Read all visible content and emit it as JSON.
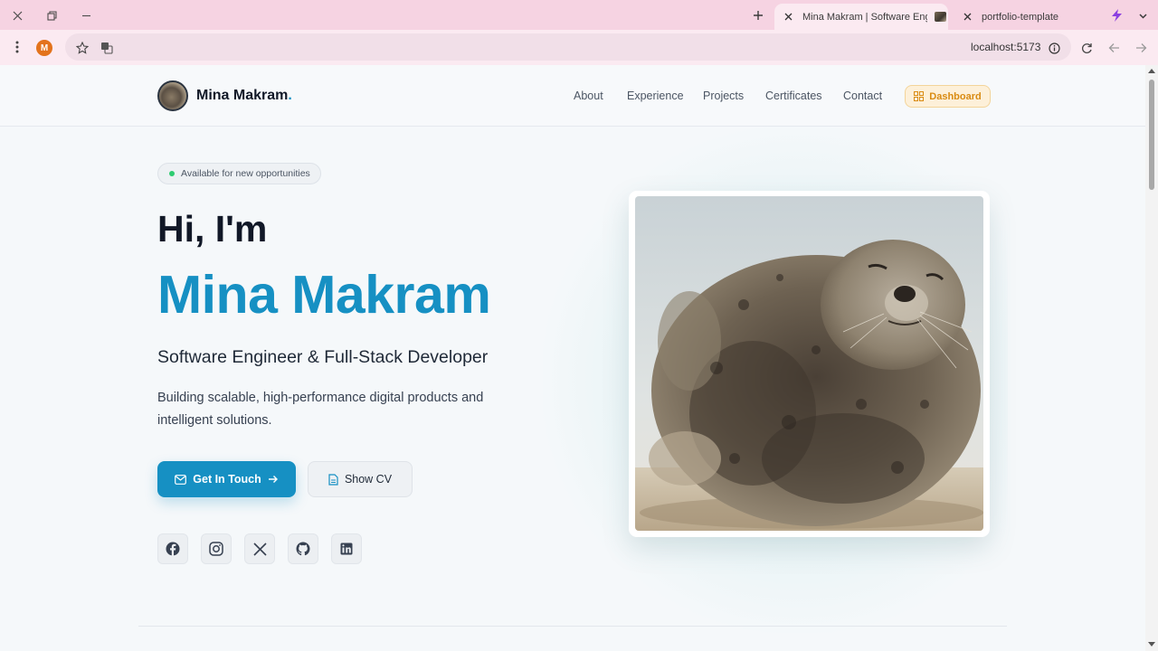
{
  "browser": {
    "tabs": [
      {
        "title": "Mina Makram | Software Engineer",
        "active": true
      },
      {
        "title": "portfolio-template",
        "active": false
      }
    ],
    "profile_initial": "M",
    "url": "localhost:5173",
    "colors": {
      "tabbar": "#f6d3e2",
      "toolbar": "#fbeaf1"
    }
  },
  "nav": {
    "logo_name": "Mina Makram",
    "logo_dot": ".",
    "links": [
      "About",
      "Experience",
      "Projects",
      "Certificates",
      "Contact"
    ],
    "dashboard_label": "Dashboard"
  },
  "hero": {
    "availability": "Available for new opportunities",
    "greeting": "Hi, I'm",
    "name": "Mina Makram",
    "role": "Software Engineer & Full-Stack Developer",
    "description": "Building scalable, high-performance digital products and intelligent solutions.",
    "primary_cta": "Get In Touch",
    "secondary_cta": "Show CV",
    "socials": [
      "facebook-icon",
      "instagram-icon",
      "x-twitter-icon",
      "github-icon",
      "linkedin-icon"
    ],
    "photo_subject": "seal"
  },
  "colors": {
    "accent": "#1690c3",
    "dashboard": "#d98b12",
    "status_dot": "#2ecc71"
  }
}
